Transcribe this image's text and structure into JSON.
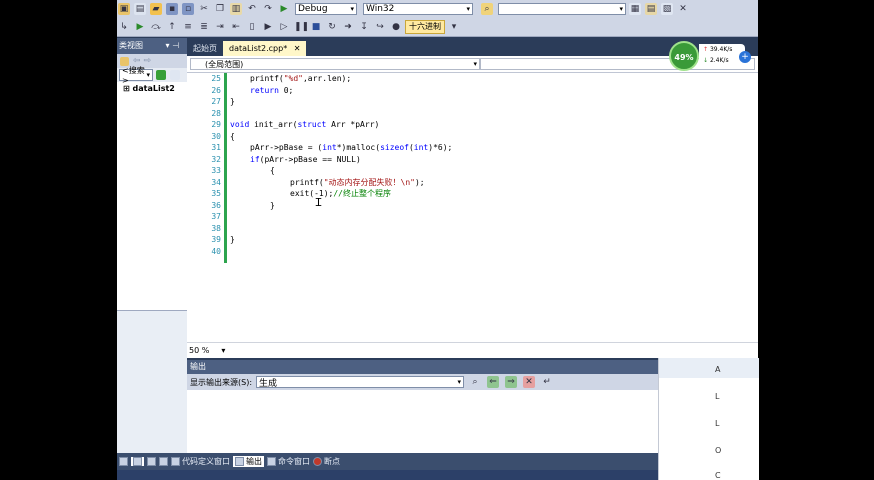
{
  "toolbar": {
    "config_value": "Debug",
    "platform_value": "Win32",
    "hex_button": "十六进制"
  },
  "left_panel": {
    "title": "类视图",
    "search_label": "<搜索>",
    "item": "dataList2"
  },
  "tabs": [
    {
      "label": "起始页"
    },
    {
      "label": "dataList2.cpp*"
    }
  ],
  "navbar": {
    "scope_value": "(全局范围)"
  },
  "code": {
    "lines": [
      {
        "num": "25",
        "indent": 2,
        "parts": [
          {
            "t": "printf(",
            "c": ""
          },
          {
            "t": "\"%d\"",
            "c": "str"
          },
          {
            "t": ",arr.len);",
            "c": ""
          }
        ]
      },
      {
        "num": "26",
        "indent": 2,
        "parts": [
          {
            "t": "return",
            "c": "kw"
          },
          {
            "t": " 0;",
            "c": ""
          }
        ]
      },
      {
        "num": "27",
        "indent": 0,
        "parts": [
          {
            "t": "}",
            "c": ""
          }
        ]
      },
      {
        "num": "28",
        "indent": 0,
        "parts": []
      },
      {
        "num": "29",
        "indent": 0,
        "parts": [
          {
            "t": "void",
            "c": "kw"
          },
          {
            "t": " init_arr(",
            "c": ""
          },
          {
            "t": "struct",
            "c": "kw"
          },
          {
            "t": " Arr *pArr)",
            "c": ""
          }
        ]
      },
      {
        "num": "30",
        "indent": 0,
        "parts": [
          {
            "t": "{",
            "c": ""
          }
        ]
      },
      {
        "num": "31",
        "indent": 2,
        "parts": [
          {
            "t": "pArr->pBase = (",
            "c": ""
          },
          {
            "t": "int",
            "c": "kw"
          },
          {
            "t": "*)malloc(",
            "c": ""
          },
          {
            "t": "sizeof",
            "c": "kw"
          },
          {
            "t": "(",
            "c": ""
          },
          {
            "t": "int",
            "c": "kw"
          },
          {
            "t": ")*6);",
            "c": ""
          }
        ]
      },
      {
        "num": "32",
        "indent": 2,
        "parts": [
          {
            "t": "if",
            "c": "kw"
          },
          {
            "t": "(pArr->pBase == NULL)",
            "c": ""
          }
        ]
      },
      {
        "num": "33",
        "indent": 4,
        "parts": [
          {
            "t": "{",
            "c": ""
          }
        ]
      },
      {
        "num": "34",
        "indent": 6,
        "parts": [
          {
            "t": "printf(",
            "c": ""
          },
          {
            "t": "\"动态内存分配失败！\\n\"",
            "c": "str"
          },
          {
            "t": ");",
            "c": ""
          }
        ]
      },
      {
        "num": "35",
        "indent": 6,
        "parts": [
          {
            "t": "exit(-1);",
            "c": ""
          },
          {
            "t": "//终止整个程序",
            "c": "cmt"
          }
        ]
      },
      {
        "num": "36",
        "indent": 4,
        "parts": [
          {
            "t": "}",
            "c": ""
          }
        ]
      },
      {
        "num": "37",
        "indent": 0,
        "parts": []
      },
      {
        "num": "38",
        "indent": 0,
        "parts": []
      },
      {
        "num": "39",
        "indent": 0,
        "parts": [
          {
            "t": "}",
            "c": ""
          }
        ]
      },
      {
        "num": "40",
        "indent": 0,
        "parts": []
      }
    ]
  },
  "zoom": {
    "value": "50 %"
  },
  "output": {
    "title": "输出",
    "source_label": "显示输出来源(S):",
    "source_value": "生成"
  },
  "bottom_tabs": [
    {
      "label": "代码定义窗口"
    },
    {
      "label": "输出"
    },
    {
      "label": "命令窗口"
    },
    {
      "label": "断点"
    }
  ],
  "perf": {
    "percent": "49%",
    "up": "39.4K/s",
    "down": "2.4K/s"
  },
  "right_letters": [
    "A",
    "L",
    "L",
    "O",
    "C"
  ]
}
